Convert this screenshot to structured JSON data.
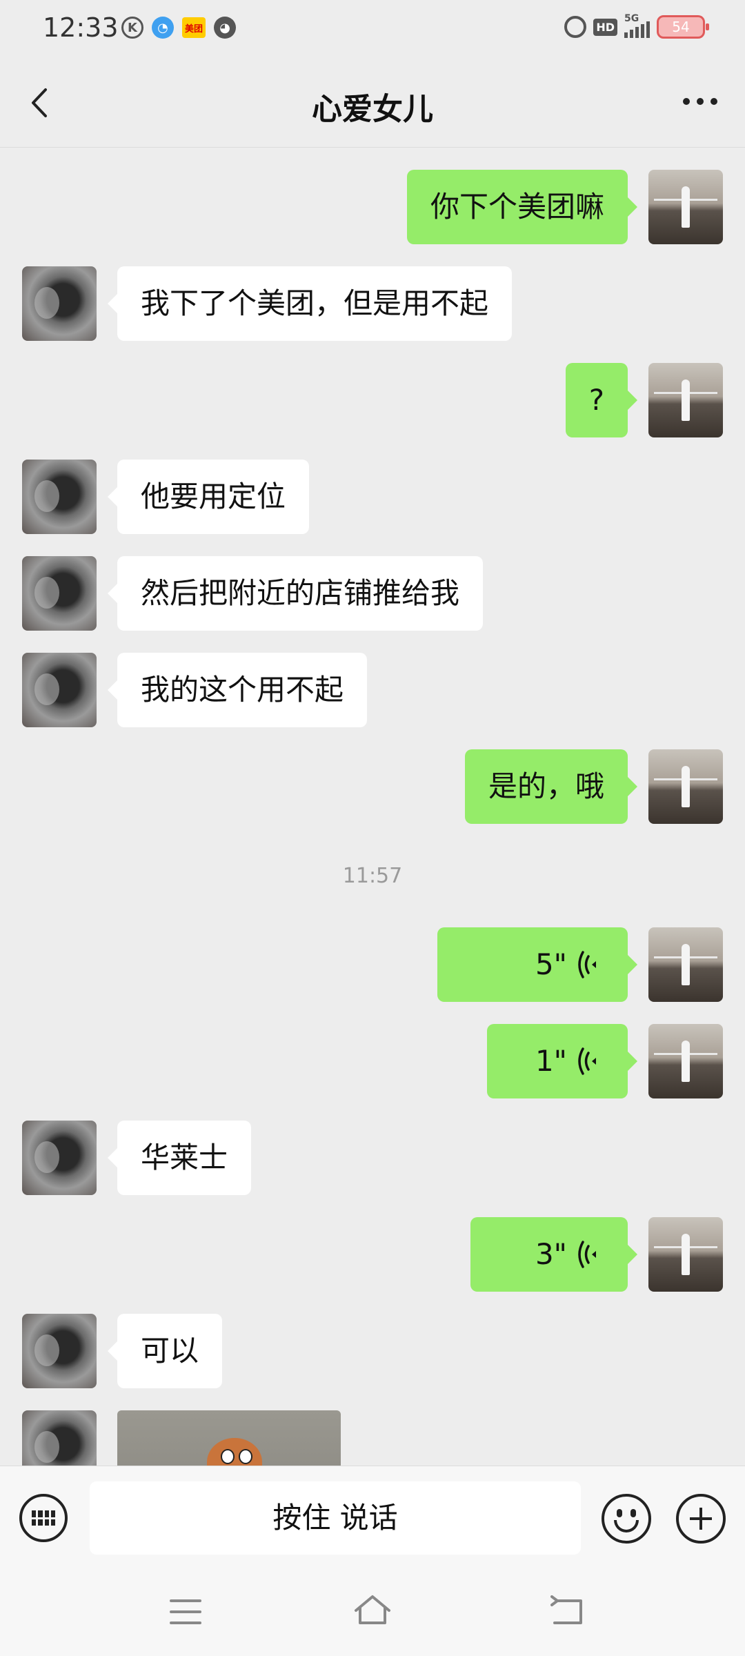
{
  "status_bar": {
    "time": "12:33",
    "left_icons": [
      "k-icon",
      "qq-browser-icon",
      "meituan-app-icon",
      "speed-gauge-icon"
    ],
    "meituan_text": "美团",
    "hd_text": "HD",
    "network_text": "5G",
    "battery": "54"
  },
  "header": {
    "title": "心爱女儿"
  },
  "messages": [
    {
      "from": "self",
      "type": "text",
      "text": "你下个美团嘛"
    },
    {
      "from": "other",
      "type": "text",
      "text": "我下了个美团，但是用不起"
    },
    {
      "from": "self",
      "type": "text",
      "text": "?"
    },
    {
      "from": "other",
      "type": "text",
      "text": "他要用定位"
    },
    {
      "from": "other",
      "type": "text",
      "text": "然后把附近的店铺推给我"
    },
    {
      "from": "other",
      "type": "text",
      "text": "我的这个用不起"
    },
    {
      "from": "self",
      "type": "text",
      "text": "是的，哦"
    },
    {
      "type": "timestamp",
      "text": "11:57"
    },
    {
      "from": "self",
      "type": "voice",
      "duration": "5\""
    },
    {
      "from": "self",
      "type": "voice",
      "duration": "1\""
    },
    {
      "from": "other",
      "type": "text",
      "text": "华莱士"
    },
    {
      "from": "self",
      "type": "voice",
      "duration": "3\""
    },
    {
      "from": "other",
      "type": "text",
      "text": "可以"
    },
    {
      "from": "other",
      "type": "image",
      "icon": "sticker-image"
    }
  ],
  "input_bar": {
    "hold_to_talk": "按住 说话"
  },
  "colors": {
    "background": "#ededed",
    "self_bubble": "#95ec69",
    "other_bubble": "#ffffff"
  }
}
